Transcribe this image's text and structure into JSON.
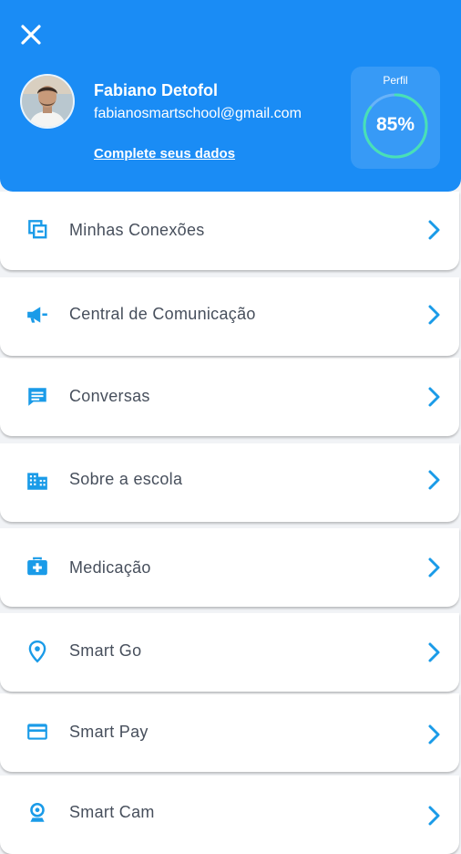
{
  "colors": {
    "brand": "#1a8cf5",
    "icon_accent": "#1a9be8",
    "progress_ring": "#48e0b6"
  },
  "header": {
    "close_icon": "close-icon",
    "user_name": "Fabiano Detofol",
    "user_email": "fabianosmartschool@gmail.com",
    "complete_link": "Complete seus dados",
    "profile": {
      "label": "Perfil",
      "percent_text": "85%",
      "percent_value": 85
    }
  },
  "menu": [
    {
      "label": "Minhas Conexões",
      "icon": "connections-icon"
    },
    {
      "label": "Central de Comunicação",
      "icon": "megaphone-icon"
    },
    {
      "label": "Conversas",
      "icon": "chat-icon"
    },
    {
      "label": "Sobre a escola",
      "icon": "building-icon"
    },
    {
      "label": "Medicação",
      "icon": "medical-kit-icon"
    },
    {
      "label": "Smart Go",
      "icon": "location-pin-icon"
    },
    {
      "label": "Smart Pay",
      "icon": "credit-card-icon"
    },
    {
      "label": "Smart Cam",
      "icon": "camera-icon"
    }
  ]
}
